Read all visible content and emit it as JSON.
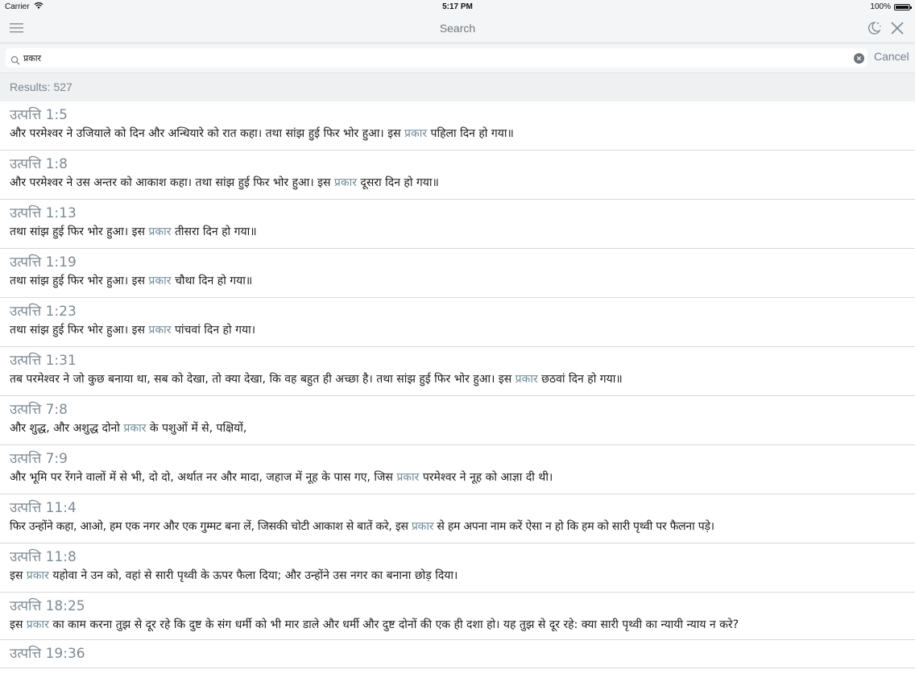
{
  "status_bar": {
    "carrier": "Carrier",
    "time": "5:17 PM",
    "battery": "100%"
  },
  "nav": {
    "title": "Search",
    "icons": [
      "menu-icon",
      "night-mode-icon",
      "close-icon"
    ]
  },
  "search": {
    "query": "प्रकार",
    "cancel_label": "Cancel",
    "icons": [
      "search-icon",
      "clear-icon"
    ]
  },
  "results_label": "Results: 527",
  "highlight_color": "#6f8a99",
  "results": [
    {
      "ref": "उत्पत्ति 1:5",
      "pre": "और परमेश्वर ने उजियाले को दिन और अन्धियारे को रात कहा। तथा सांझ हुई फिर भोर हुआ। इस ",
      "match": "प्रकार",
      "post": " पहिला दिन हो गया॥"
    },
    {
      "ref": "उत्पत्ति 1:8",
      "pre": "और परमेश्वर ने उस अन्तर को आकाश कहा। तथा सांझ हुई फिर भोर हुआ। इस ",
      "match": "प्रकार",
      "post": " दूसरा दिन हो गया॥"
    },
    {
      "ref": "उत्पत्ति 1:13",
      "pre": "तथा सांझ हुई फिर भोर हुआ। इस ",
      "match": "प्रकार",
      "post": " तीसरा दिन हो गया॥"
    },
    {
      "ref": "उत्पत्ति 1:19",
      "pre": "तथा सांझ हुई फिर भोर हुआ। इस ",
      "match": "प्रकार",
      "post": " चौथा दिन हो गया॥"
    },
    {
      "ref": "उत्पत्ति 1:23",
      "pre": "तथा सांझ हुई फिर भोर हुआ। इस ",
      "match": "प्रकार",
      "post": " पांचवां दिन हो गया।"
    },
    {
      "ref": "उत्पत्ति 1:31",
      "pre": "तब परमेश्वर ने जो कुछ बनाया था, सब को देखा, तो क्या देखा, कि वह बहुत ही अच्छा है। तथा सांझ हुई फिर भोर हुआ। इस ",
      "match": "प्रकार",
      "post": " छठवां दिन हो गया॥"
    },
    {
      "ref": "उत्पत्ति 7:8",
      "pre": "और शुद्ध, और अशुद्ध दोनो ",
      "match": "प्रकार",
      "post": " के पशुओं में से, पक्षियों,"
    },
    {
      "ref": "उत्पत्ति 7:9",
      "pre": "और भूमि पर रेंगने वालों में से भी, दो दो, अर्थात नर और मादा, जहाज में नूह के पास गए, जिस ",
      "match": "प्रकार",
      "post": " परमेश्वर ने नूह को आज्ञा दी थी।"
    },
    {
      "ref": "उत्पत्ति 11:4",
      "pre": "फिर उन्होंने कहा, आओ, हम एक नगर और एक गुम्मट बना लें, जिसकी चोटी आकाश से बातें करे, इस ",
      "match": "प्रकार",
      "post": " से हम अपना नाम करें ऐसा न हो कि हम को सारी पृथ्वी पर फैलना पड़े।"
    },
    {
      "ref": "उत्पत्ति 11:8",
      "pre": "इस ",
      "match": "प्रकार",
      "post": " यहोवा ने उन को, वहां से सारी पृथ्वी के ऊपर फैला दिया; और उन्होंने उस नगर का बनाना छोड़ दिया।"
    },
    {
      "ref": "उत्पत्ति 18:25",
      "pre": "इस ",
      "match": "प्रकार",
      "post": " का काम करना तुझ से दूर रहे कि दुष्ट के संग धर्मी को भी मार डाले और धर्मी और दुष्ट दोनों की एक ही दशा हो। यह तुझ से दूर रहे: क्या सारी पृथ्वी का न्यायी न्याय न करे?"
    },
    {
      "ref": "उत्पत्ति 19:36",
      "pre": "",
      "match": "",
      "post": ""
    }
  ]
}
